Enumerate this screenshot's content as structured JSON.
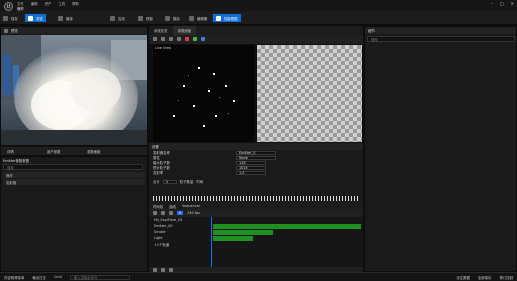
{
  "app": {
    "logo": "U",
    "tab": "爆炸"
  },
  "menu": [
    "文件",
    "编辑",
    "资产",
    "工具",
    "帮助"
  ],
  "toolbar": [
    "保存",
    "浏览",
    "编译",
    "应用",
    "视窗",
    "模拟",
    "编辑器",
    "性能视图"
  ],
  "preview": {
    "title": "预览"
  },
  "subtabs": [
    "详情",
    "用户参数",
    "参数面板"
  ],
  "left_list": {
    "header": "Emitter参数参数",
    "search": "搜索",
    "rows": [
      "爆炸",
      "发射器"
    ]
  },
  "mid_tabs": [
    "系统总览",
    "参数面板"
  ],
  "graph": {
    "label": "Live View"
  },
  "props": {
    "header": "设置",
    "rows": [
      {
        "label": "发射器名称",
        "value": "Emitter_0"
      },
      {
        "label": "属性",
        "value": "None"
      },
      {
        "label": "最大粒子数",
        "value": "128"
      },
      {
        "label": "预计粒子数",
        "value": "1024"
      },
      {
        "label": "发射率",
        "value": "1.0"
      }
    ],
    "footer": [
      "合计",
      "4",
      "粒子数量",
      "时间"
    ]
  },
  "timeline": {
    "tabs": [
      "时间线",
      "曲线",
      "Sequencer"
    ],
    "tracks": [
      "Hit_ExplFlare_03",
      "Emitter_00",
      "Smoke",
      "Light",
      "+1个轨道"
    ],
    "playhead": "0",
    "frames": "240 fps"
  },
  "right": {
    "title": "细节",
    "search": "搜索"
  },
  "status": {
    "left": [
      "内容侧滑菜单",
      "输出日志"
    ],
    "cmd_label": "Cmd",
    "cmd_placeholder": "输入控制台命令",
    "right": [
      "派生数据",
      "全部保存",
      "修订控制"
    ]
  },
  "colors": {
    "accent": "#0f6fd6",
    "track": "#1f8f1f",
    "playhead": "#1a6fff"
  }
}
